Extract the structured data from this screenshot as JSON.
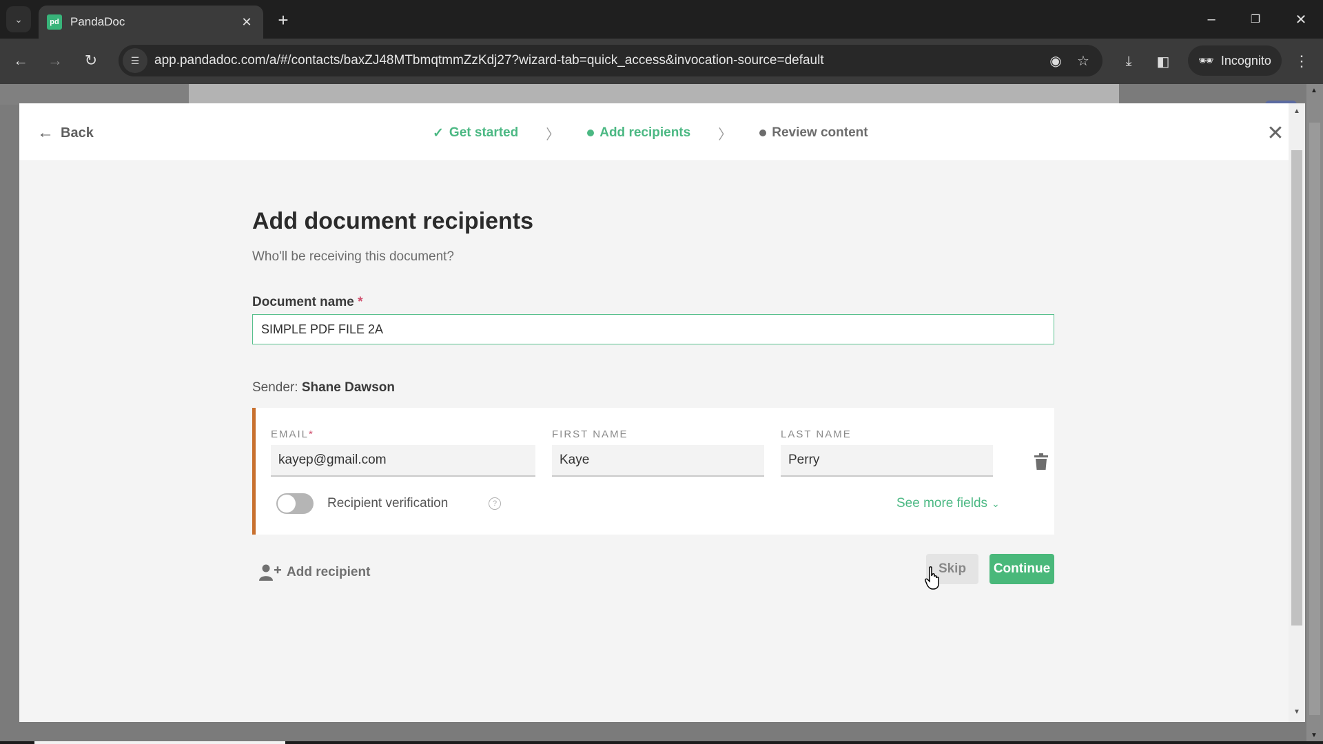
{
  "browser": {
    "tab": {
      "title": "PandaDoc",
      "favicon": "pd"
    },
    "url": "app.pandadoc.com/a/#/contacts/baxZJ48MTbmqtmmZzKdj27?wizard-tab=quick_access&invocation-source=default",
    "incognito_label": "Incognito",
    "icons": {
      "tab_list": "chevron-down-icon",
      "new_tab": "plus-icon",
      "back": "arrow-left-icon",
      "forward": "arrow-right-icon",
      "reload": "reload-icon",
      "site_info": "tune-icon",
      "eye_off": "eye-off-icon",
      "bookmark": "star-icon",
      "download": "download-icon",
      "side_panel": "side-panel-icon",
      "menu": "more-vert-icon"
    }
  },
  "wizard": {
    "back_label": "Back",
    "steps": [
      {
        "label": "Get started",
        "state": "done"
      },
      {
        "label": "Add recipients",
        "state": "current"
      },
      {
        "label": "Review content",
        "state": "pending"
      }
    ],
    "title": "Add document recipients",
    "subtitle": "Who'll be receiving this document?",
    "document_name": {
      "label": "Document name",
      "required_mark": "*",
      "value": "SIMPLE PDF FILE 2A"
    },
    "sender": {
      "prefix": "Sender:",
      "name": "Shane Dawson"
    },
    "recipients": [
      {
        "email_label": "EMAIL",
        "email_required_mark": "*",
        "email": "kayep@gmail.com",
        "first_name_label": "FIRST NAME",
        "first_name": "Kaye",
        "last_name_label": "LAST NAME",
        "last_name": "Perry",
        "verification_label": "Recipient verification",
        "verification_enabled": false,
        "see_more_label": "See more fields"
      }
    ],
    "add_recipient_label": "Add recipient",
    "skip_label": "Skip",
    "continue_label": "Continue"
  },
  "colors": {
    "accent_green": "#4bb883",
    "continue_button": "#49b87a",
    "recipient_bar": "#c8702e",
    "required": "#d0506e"
  }
}
